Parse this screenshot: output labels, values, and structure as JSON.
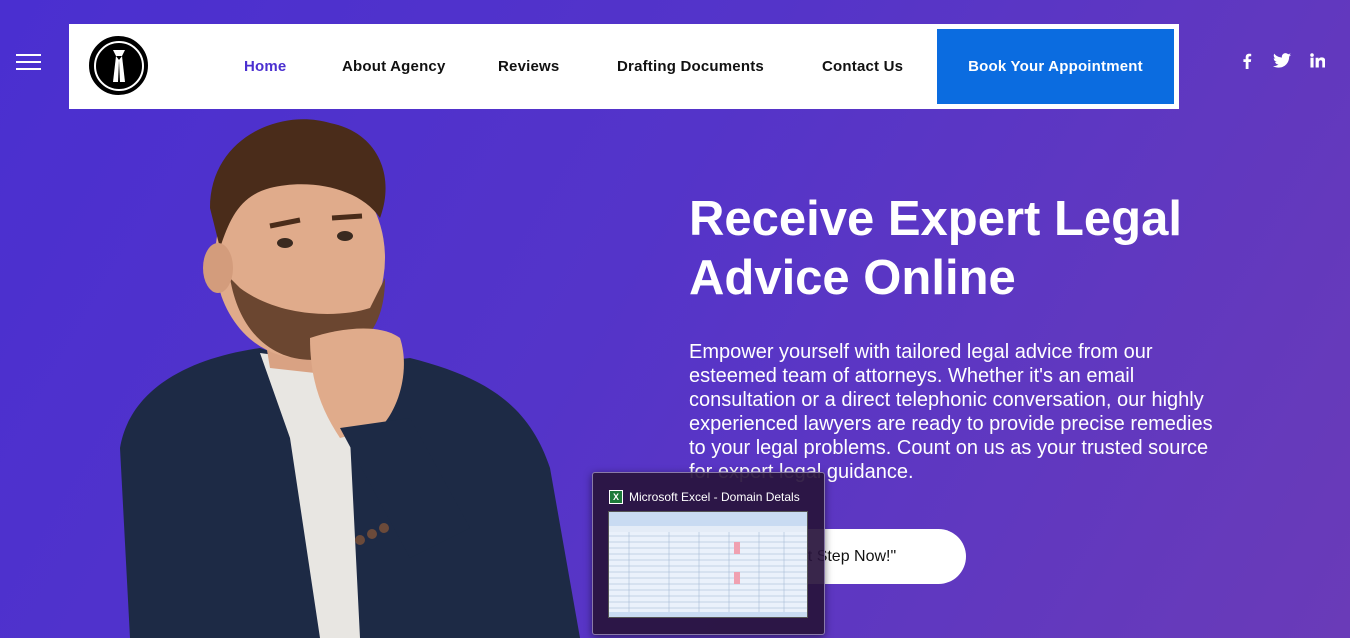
{
  "nav": {
    "links": [
      {
        "label": "Home",
        "active": true
      },
      {
        "label": "About Agency"
      },
      {
        "label": "Reviews"
      },
      {
        "label": "Drafting Documents"
      },
      {
        "label": "Contact Us"
      }
    ],
    "book_label": "Book Your Appointment"
  },
  "social": [
    "facebook-icon",
    "twitter-icon",
    "linkedin-icon"
  ],
  "hero": {
    "title_line1": "Receive Expert Legal",
    "title_line2": "Advice Online",
    "description": "Empower yourself with tailored legal advice from our esteemed team of attorneys. Whether it's an email consultation or a direct telephonic conversation, our highly experienced lawyers are ready to provide precise remedies to your legal problems. Count on us as your trusted source for expert legal guidance.",
    "cta_label": "st Step Now!\""
  },
  "taskbar_preview": {
    "title": "Microsoft Excel - Domain Detals"
  },
  "colors": {
    "accent": "#4a2fd0",
    "button": "#0b6ce0",
    "background": "#5434c9"
  }
}
